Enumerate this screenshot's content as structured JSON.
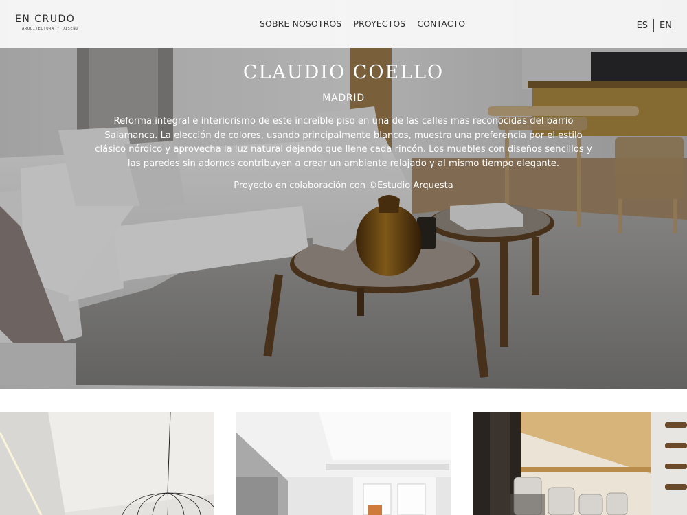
{
  "brand": {
    "name": "EN CRUDO",
    "tagline": "ARQUITECTURA Y DISEÑO"
  },
  "nav": {
    "items": [
      {
        "label": "SOBRE NOSOTROS"
      },
      {
        "label": "PROYECTOS"
      },
      {
        "label": "CONTACTO"
      }
    ]
  },
  "languages": {
    "es": "ES",
    "en": "EN"
  },
  "hero": {
    "title": "CLAUDIO COELLO",
    "city": "MADRID",
    "description": "Reforma integral e interiorismo de este increíble piso en una de las calles mas reconocidas del barrio Salamanca. La elección de colores, usando principalmente blancos, muestra una preferencia por el estilo clásico nórdico y aprovecha la luz natural dejando que llene cada rincón. Los muebles con diseños sencillos y las paredes sin adornos contribuyen a crear un ambiente relajado y al mismo tiempo elegante.",
    "credit": "Proyecto en colaboración con ©Estudio Arquesta"
  },
  "colors": {
    "header_bg": "#fafafa",
    "text_dark": "#2f2f2f",
    "hero_text": "#ffffff"
  }
}
